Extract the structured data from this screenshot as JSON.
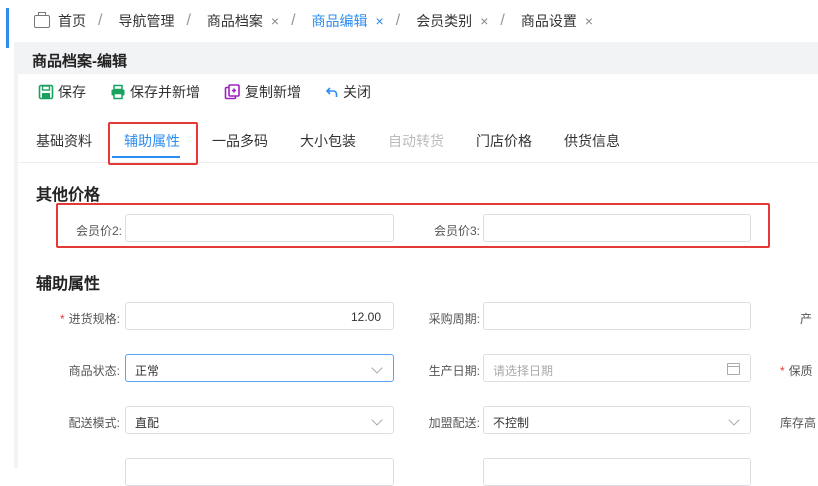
{
  "tabs": [
    {
      "label": "首页",
      "closable": false
    },
    {
      "label": "导航管理",
      "closable": false
    },
    {
      "label": "商品档案",
      "closable": true
    },
    {
      "label": "商品编辑",
      "closable": true,
      "active": true
    },
    {
      "label": "会员类别",
      "closable": true
    },
    {
      "label": "商品设置",
      "closable": true
    }
  ],
  "tab_close_glyph": "×",
  "tab_separator": "/",
  "page_title": "商品档案-编辑",
  "toolbar": {
    "save": "保存",
    "save_new": "保存并新增",
    "copy_new": "复制新增",
    "close": "关闭"
  },
  "subtabs": [
    "基础资料",
    "辅助属性",
    "一品多码",
    "大小包装",
    "自动转货",
    "门店价格",
    "供货信息"
  ],
  "active_subtab": "辅助属性",
  "disabled_subtab": "自动转货",
  "sections": {
    "other_price": "其他价格",
    "aux_attr": "辅助属性"
  },
  "fields": {
    "member_price2": {
      "label": "会员价2:",
      "value": ""
    },
    "member_price3": {
      "label": "会员价3:",
      "value": ""
    },
    "purchase_spec": {
      "label": "进货规格:",
      "value": "12.00",
      "required": true
    },
    "purchase_cycle": {
      "label": "采购周期:",
      "value": ""
    },
    "origin_partial": {
      "label": "产"
    },
    "product_status": {
      "label": "商品状态:",
      "value": "正常"
    },
    "production_date": {
      "label": "生产日期:",
      "placeholder": "请选择日期"
    },
    "shelf_partial": {
      "label": "保质",
      "required": true
    },
    "delivery_mode": {
      "label": "配送模式:",
      "value": "直配"
    },
    "franchise_delivery": {
      "label": "加盟配送:",
      "value": "不控制"
    },
    "stock_partial": {
      "label": "库存高"
    }
  },
  "required_mark": "*",
  "colors": {
    "accent": "#2d8cf0",
    "highlight": "#e53935"
  }
}
